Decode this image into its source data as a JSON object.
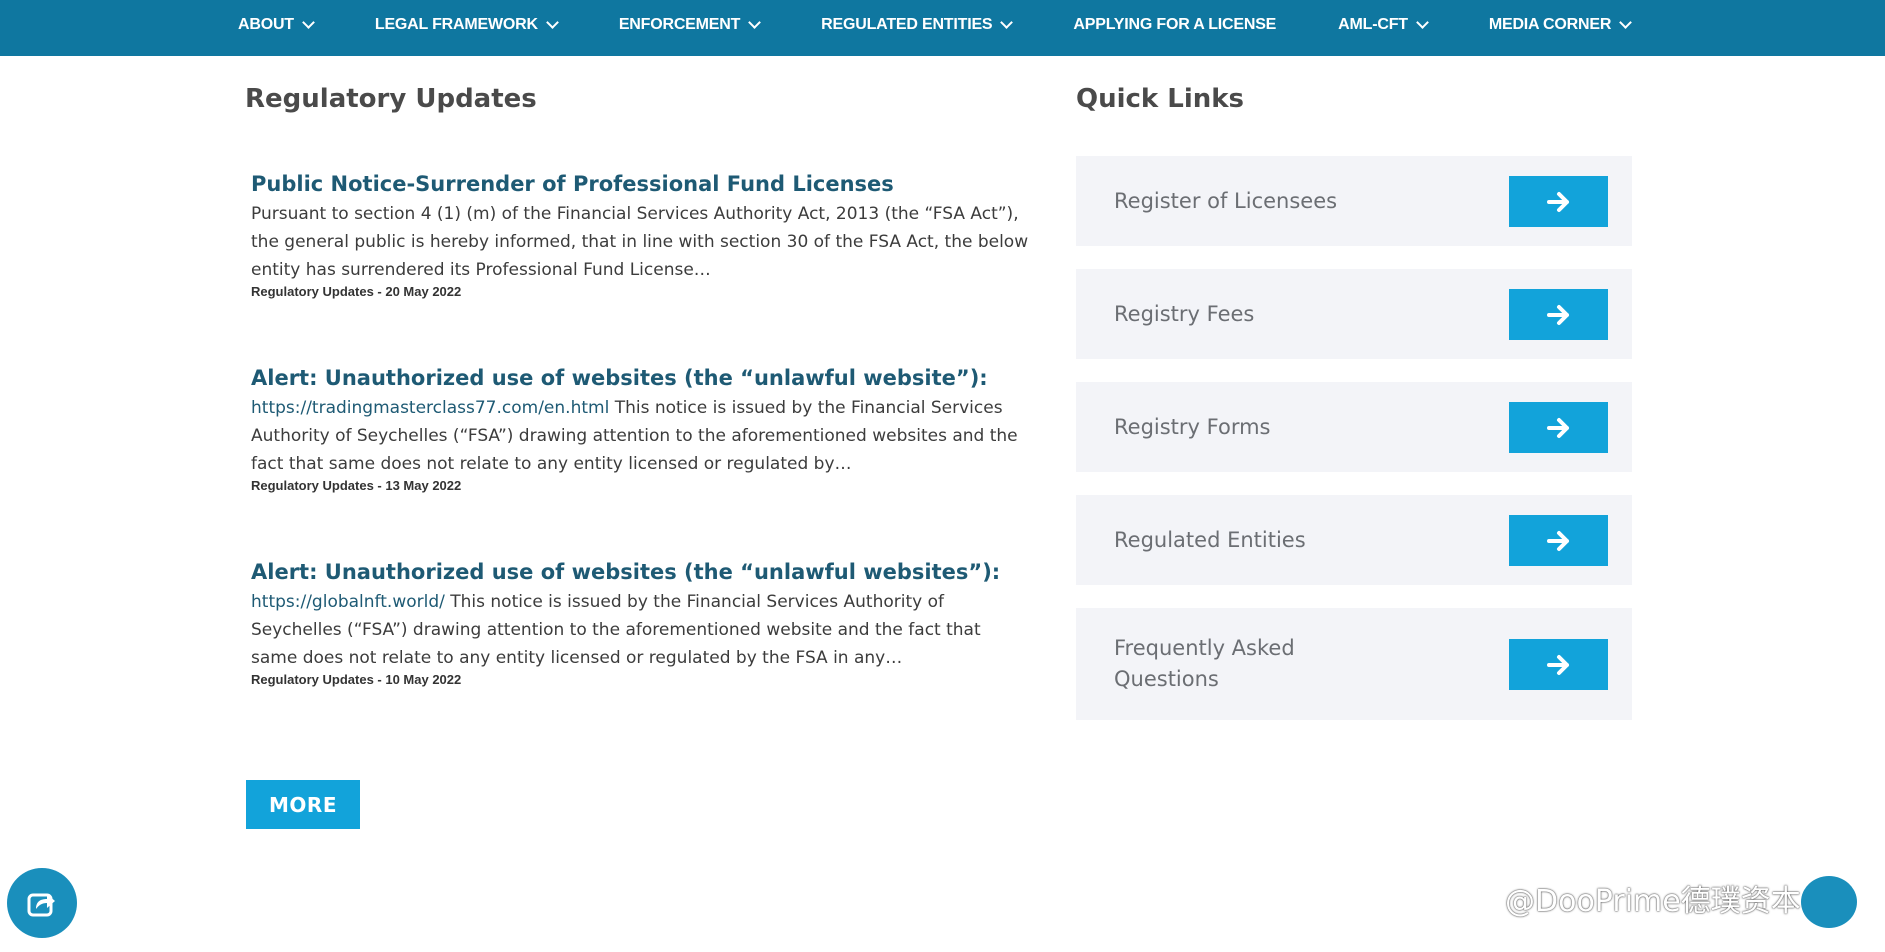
{
  "nav": {
    "items": [
      {
        "label": "ABOUT",
        "dropdown": true
      },
      {
        "label": "LEGAL FRAMEWORK",
        "dropdown": true
      },
      {
        "label": "ENFORCEMENT",
        "dropdown": true
      },
      {
        "label": "REGULATED ENTITIES",
        "dropdown": true
      },
      {
        "label": "APPLYING FOR A LICENSE",
        "dropdown": false
      },
      {
        "label": "AML-CFT",
        "dropdown": true
      },
      {
        "label": "MEDIA CORNER",
        "dropdown": true
      }
    ]
  },
  "updates": {
    "title": "Regulatory Updates",
    "articles": [
      {
        "title": "Public Notice-Surrender of Professional Fund Licenses",
        "link": "",
        "body": "Pursuant to section 4 (1) (m) of the Financial Services Authority Act, 2013 (the “FSA Act”), the general public is hereby informed, that in line with section 30 of the FSA Act, the below entity has surrendered its Professional Fund License…",
        "meta": "Regulatory Updates - 20 May 2022"
      },
      {
        "title": "Alert: Unauthorized use of websites (the “unlawful website”):",
        "link": " https://tradingmasterclass77.com/en.html",
        "body": " This notice is issued by the Financial Services Authority of Seychelles (“FSA”) drawing attention to the aforementioned websites and the fact that same does not relate to any entity licensed or regulated by…",
        "meta": "Regulatory Updates - 13 May 2022"
      },
      {
        "title": "Alert: Unauthorized use of websites (the “unlawful websites”):",
        "link": "https://globalnft.world/",
        "body": " This notice is issued by the Financial Services Authority of Seychelles (“FSA”) drawing attention to the aforementioned website and the fact that same does not relate to any entity licensed or regulated by the FSA in any…",
        "meta": "Regulatory Updates - 10 May 2022"
      }
    ],
    "more_label": "MORE"
  },
  "quick_links": {
    "title": "Quick Links",
    "items": [
      {
        "label": "Register of Licensees"
      },
      {
        "label": "Registry Fees"
      },
      {
        "label": "Registry Forms"
      },
      {
        "label": "Regulated Entities"
      },
      {
        "label": "Frequently Asked Questions"
      }
    ]
  },
  "watermark": "@DooPrime德璞资本",
  "colors": {
    "nav_bg": "#0f77a0",
    "accent": "#12a3da",
    "title_link": "#1e5a74",
    "card_bg": "#f3f4f8"
  }
}
